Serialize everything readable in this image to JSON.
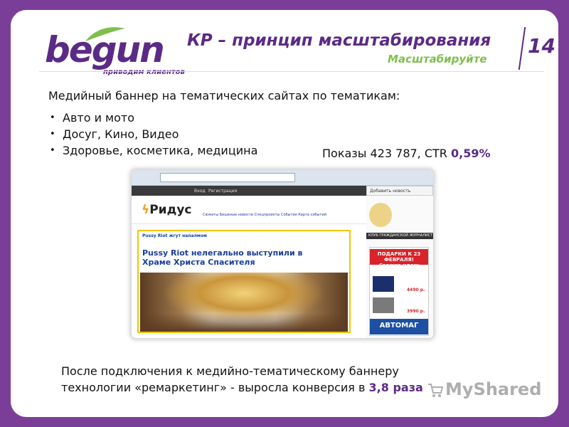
{
  "logo": {
    "brand": "begun",
    "tagline": "приводим клиентов"
  },
  "header": {
    "title": "КР – принцип масштабирования",
    "subtitle": "Масштабируйте",
    "slide_number": "14"
  },
  "body": {
    "intro": "Медийный баннер на тематических сайтах по тематикам:",
    "bullets": [
      "Авто и мото",
      "Досуг, Кино, Видео",
      "Здоровье, косметика, медицина"
    ],
    "stats_prefix": "Показы 423 787,  CTR ",
    "stats_ctr": "0,59%"
  },
  "screenshot": {
    "nav_items": [
      "Вход",
      "Регистрация"
    ],
    "tab_label": "Добавить новость",
    "site_logo_text": "Ридус",
    "site_links": "Сюжеты  Бешеные новости  Спецпроекты  События  Карта событий",
    "article_kicker": "Pussy Riot жгут напалмом",
    "article_title": "Pussy Riot нелегально выступили в Храме Христа Спасителя",
    "side_strip": "КЛУБ ГРАЖДАНСКОЙ ЖУРНАЛИСТ",
    "ad_headline": "ПОДАРКИ К 23 ФЕВРАЛЯ!",
    "ad_sub": "Свежие идеи:",
    "ad_price_1": "4490 р.",
    "ad_price_2": "3990 р.",
    "ad_brand": "АВТОМАГ"
  },
  "conclusion": {
    "line1": "После подключения к медийно-тематическому баннеру",
    "line2_prefix": "технологии «ремаркетинг» - выросла конверсия в ",
    "line2_highlight": "3,8 раза"
  },
  "watermark": {
    "text": "MyShared"
  },
  "colors": {
    "background": "#7b3e98",
    "brand_purple": "#5b2a86",
    "accent_green": "#7fbf4d"
  }
}
